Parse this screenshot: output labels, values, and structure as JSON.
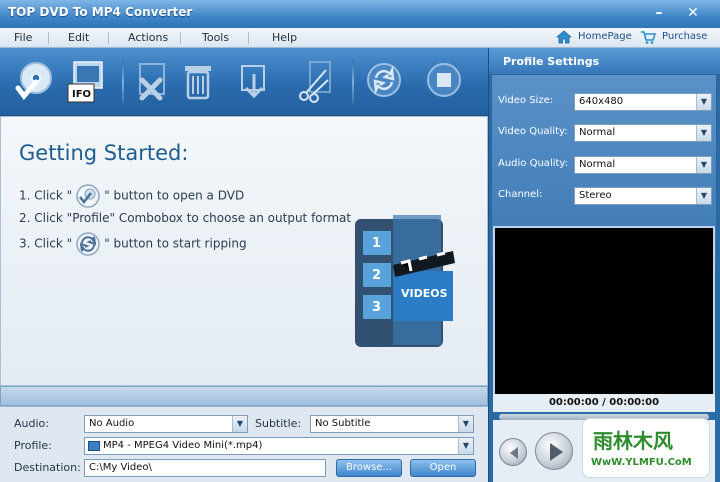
{
  "window": {
    "title": "TOP DVD To MP4 Converter"
  },
  "menu": [
    "File",
    "Edit",
    "Actions",
    "Tools",
    "Help"
  ],
  "links": {
    "homepage": "HomePage",
    "purchase": "Purchase"
  },
  "toolbar": {
    "buttons": [
      {
        "name": "open-dvd",
        "icon": "dvd-disc-icon"
      },
      {
        "name": "open-ifo",
        "icon": "ifo-film-icon",
        "label": "IFO"
      },
      {
        "name": "remove",
        "icon": "remove-icon"
      },
      {
        "name": "clear",
        "icon": "trash-icon"
      },
      {
        "name": "merge",
        "icon": "merge-icon"
      },
      {
        "name": "trim",
        "icon": "scissors-icon"
      },
      {
        "name": "convert",
        "icon": "refresh-icon"
      },
      {
        "name": "stop",
        "icon": "stop-icon"
      }
    ]
  },
  "getting_started": {
    "title": "Getting Started:",
    "step1_pre": "1. Click \"",
    "step1_post": "\" button to open a DVD",
    "step2": "2. Click \"Profile\" Combobox to choose an output format",
    "step3_pre": "3. Click \"",
    "step3_post": "\" button to start ripping",
    "art_labels": [
      "1",
      "2",
      "3"
    ],
    "art_caption": "VIDEOS"
  },
  "bottom": {
    "audio_label": "Audio:",
    "audio_value": "No Audio",
    "subtitle_label": "Subtitle:",
    "subtitle_value": "No Subtitle",
    "profile_label": "Profile:",
    "profile_value": "MP4 - MPEG4 Video Mini(*.mp4)",
    "destination_label": "Destination:",
    "destination_value": "C:\\My Video\\",
    "browse_label": "Browse...",
    "open_label": "Open"
  },
  "profile_settings": {
    "header": "Profile  Settings",
    "video_size_label": "Video  Size:",
    "video_size_value": "640x480",
    "video_quality_label": "Video  Quality:",
    "video_quality_value": "Normal",
    "audio_quality_label": "Audio  Quality:",
    "audio_quality_value": "Normal",
    "channel_label": "Channel:",
    "channel_value": "Stereo"
  },
  "player": {
    "time": "00:00:00 / 00:00:00"
  },
  "watermark": {
    "text": "雨林木风",
    "url": "WwW.YLMFU.CoM"
  }
}
